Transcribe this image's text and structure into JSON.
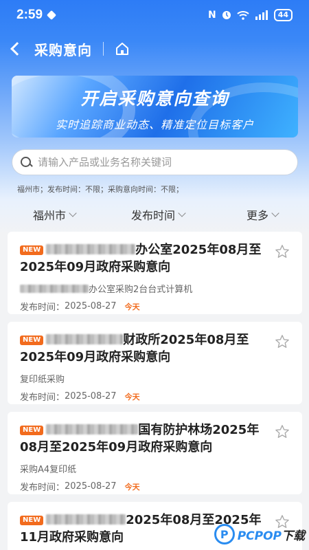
{
  "status_bar": {
    "time": "2:59",
    "nfc": "N",
    "battery": "44"
  },
  "header": {
    "title": "采购意向"
  },
  "banner": {
    "title": "开启采购意向查询",
    "subtitle": "实时追踪商业动态、精准定位目标客户"
  },
  "search": {
    "placeholder": "请输入产品或业务名称关键词"
  },
  "filter_summary": "福州市；发布时间：不限；采购意向时间：不限；",
  "filters": {
    "city": "福州市",
    "publish_time": "发布时间",
    "more": "更多"
  },
  "cards": [
    {
      "badge": "NEW",
      "title": "办公室2025年08月至2025年09月政府采购意向",
      "desc": "办公室采购2台台式计算机",
      "meta_label": "发布时间：",
      "date": "2025-08-27",
      "today": "今天"
    },
    {
      "badge": "NEW",
      "title": "财政所2025年08月至2025年09月政府采购意向",
      "desc": "复印纸采购",
      "meta_label": "发布时间：",
      "date": "2025-08-27",
      "today": "今天"
    },
    {
      "badge": "NEW",
      "title": "国有防护林场2025年08月至2025年09月政府采购意向",
      "desc": "采购A4复印纸",
      "meta_label": "发布时间：",
      "date": "2025-08-27",
      "today": "今天"
    },
    {
      "badge": "NEW",
      "title": "2025年08月至2025年11月政府采购意向",
      "desc": "",
      "meta_label": "",
      "date": "",
      "today": ""
    }
  ],
  "watermark": {
    "brand": "PCPOP",
    "suffix": "下载",
    "small": "PCPOP Download"
  },
  "colors": {
    "primary": "#2d7cf6",
    "badge": "#f26b1d",
    "today": "#f26b1d"
  }
}
